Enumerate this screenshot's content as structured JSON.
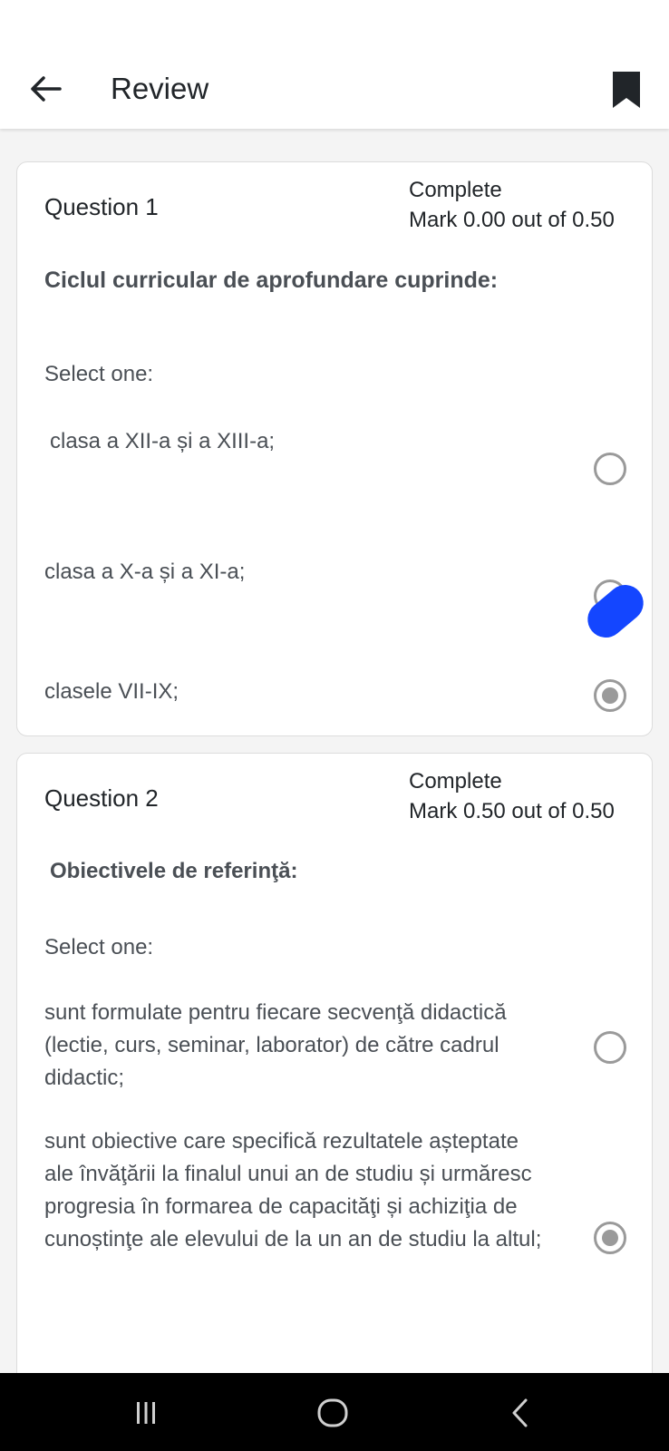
{
  "header": {
    "title": "Review"
  },
  "questions": [
    {
      "title": "Question 1",
      "state": "Complete",
      "mark": "Mark 0.00 out of 0.50",
      "text": "Ciclul curricular de aprofundare cuprinde:",
      "select_label": "Select one:",
      "options": [
        {
          "label": "clasa a XII-a și a XIII-a;",
          "selected": false
        },
        {
          "label": "clasa a X-a și a XI-a;",
          "selected": false
        },
        {
          "label": "clasele VII-IX;",
          "selected": true
        }
      ]
    },
    {
      "title": "Question 2",
      "state": "Complete",
      "mark": "Mark 0.50 out of 0.50",
      "text": "Obiectivele de referinţă:",
      "select_label": "Select one:",
      "options": [
        {
          "label": "sunt formulate pentru fiecare secvenţă didactică (lectie, curs, seminar, laborator) de către cadrul didactic;",
          "selected": false
        },
        {
          "label": "sunt obiective care specifică rezultatele așteptate ale învăţării la finalul unui an de studiu și urmăresc progresia în formarea de capacităţi și  achiziţia de cunoștinţe ale elevului de la un an de studiu la altul;",
          "selected": true
        }
      ]
    }
  ],
  "colors": {
    "accent_blob": "#1446ff",
    "radio": "#9a9a9a",
    "nav_bar": "#000000"
  },
  "icons": {
    "back": "arrow-left-icon",
    "bookmark": "bookmark-icon",
    "nav_recents": "recents-icon",
    "nav_home": "home-icon",
    "nav_back": "nav-back-icon"
  }
}
